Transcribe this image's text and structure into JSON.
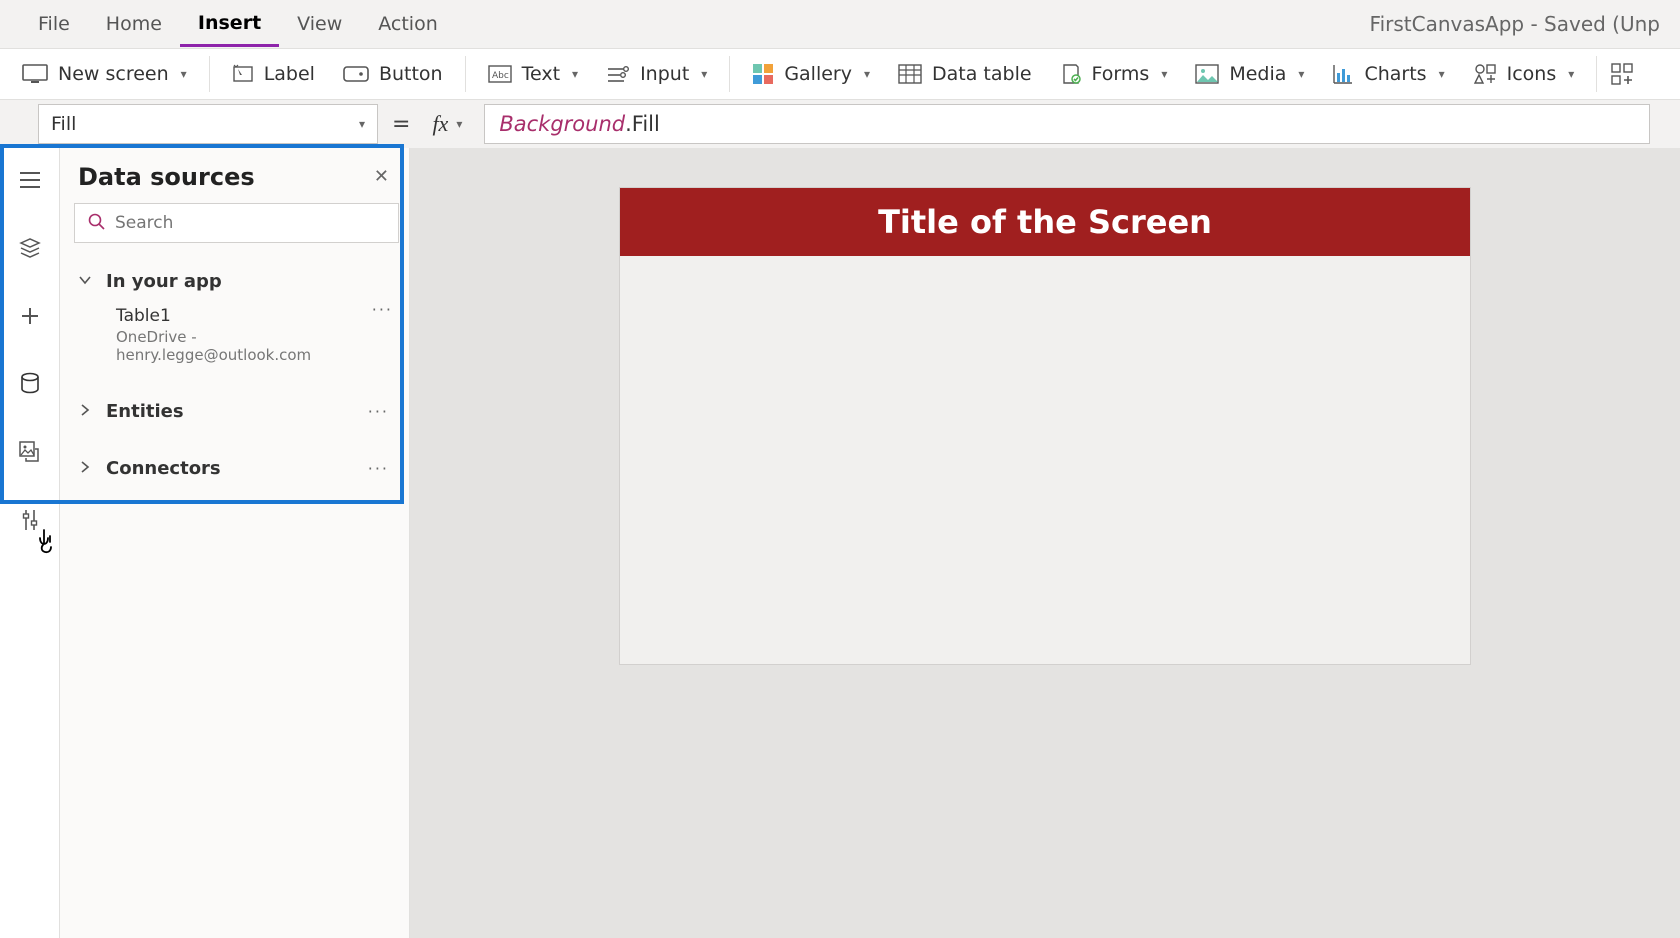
{
  "menubar": {
    "items": [
      "File",
      "Home",
      "Insert",
      "View",
      "Action"
    ],
    "active_index": 2,
    "app_title": "FirstCanvasApp - Saved (Unp"
  },
  "ribbon": {
    "new_screen": "New screen",
    "label": "Label",
    "button": "Button",
    "text": "Text",
    "input": "Input",
    "gallery": "Gallery",
    "data_table": "Data table",
    "forms": "Forms",
    "media": "Media",
    "charts": "Charts",
    "icons": "Icons"
  },
  "formula": {
    "property": "Fill",
    "object": "Background",
    "prop": "Fill"
  },
  "panel": {
    "title": "Data sources",
    "search_placeholder": "Search",
    "in_your_app": "In your app",
    "entities": "Entities",
    "connectors": "Connectors",
    "datasource": {
      "name": "Table1",
      "subtitle": "OneDrive - henry.legge@outlook.com"
    }
  },
  "canvas": {
    "title": "Title of the Screen"
  }
}
